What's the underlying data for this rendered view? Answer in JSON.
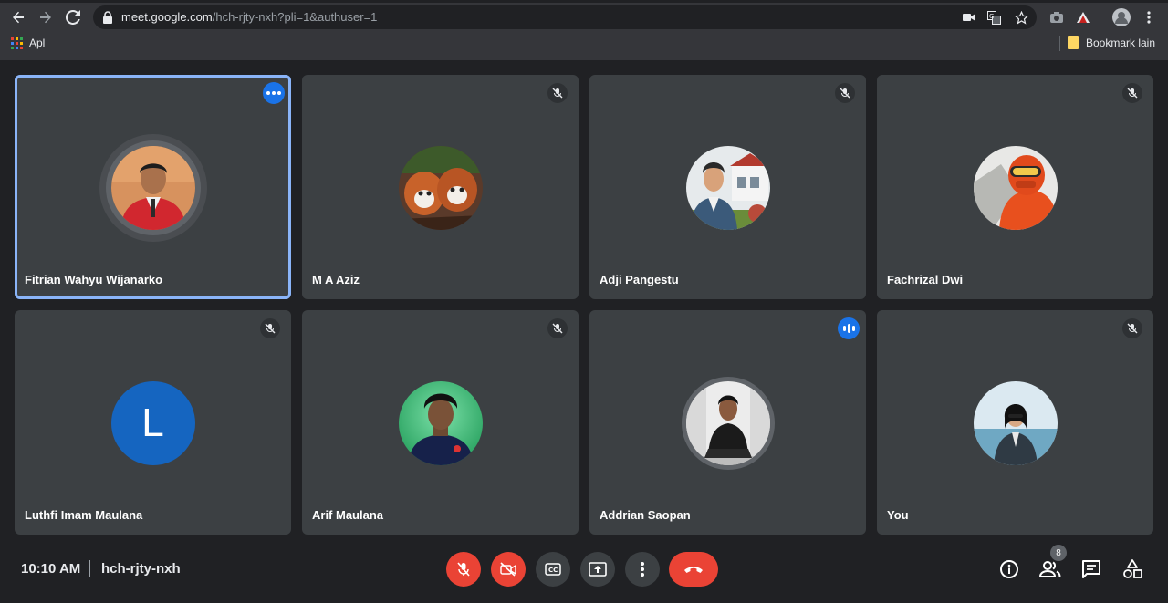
{
  "browser": {
    "url_host": "meet.google.com",
    "url_path": "/hch-rjty-nxh?pli=1&authuser=1",
    "bookmarks": {
      "apps_label": "Apl",
      "other_label": "Bookmark lain"
    }
  },
  "participants": [
    {
      "name": "Fitrian Wahyu Wijanarko",
      "status": "more-options",
      "avatar": "photo"
    },
    {
      "name": "M A Aziz",
      "status": "muted",
      "avatar": "photo"
    },
    {
      "name": "Adji Pangestu",
      "status": "muted",
      "avatar": "photo"
    },
    {
      "name": "Fachrizal Dwi",
      "status": "muted",
      "avatar": "photo"
    },
    {
      "name": "Luthfi Imam Maulana",
      "status": "muted",
      "avatar": "letter",
      "letter": "L",
      "avatar_color": "#1565c0"
    },
    {
      "name": "Arif Maulana",
      "status": "muted",
      "avatar": "photo"
    },
    {
      "name": "Addrian Saopan",
      "status": "speaking",
      "avatar": "photo"
    },
    {
      "name": "You",
      "status": "muted",
      "avatar": "photo"
    }
  ],
  "meeting": {
    "time": "10:10 AM",
    "code": "hch-rjty-nxh",
    "people_count": "8"
  },
  "colors": {
    "accent": "#1a73e8",
    "danger": "#ea4335",
    "tile_bg": "#3c4043",
    "page_bg": "#202124"
  },
  "controls": [
    "mic-off-icon",
    "camera-off-icon",
    "captions-icon",
    "present-icon",
    "more-vert-icon",
    "end-call-icon"
  ],
  "right_controls": [
    "info-icon",
    "people-icon",
    "chat-icon",
    "activities-icon"
  ]
}
